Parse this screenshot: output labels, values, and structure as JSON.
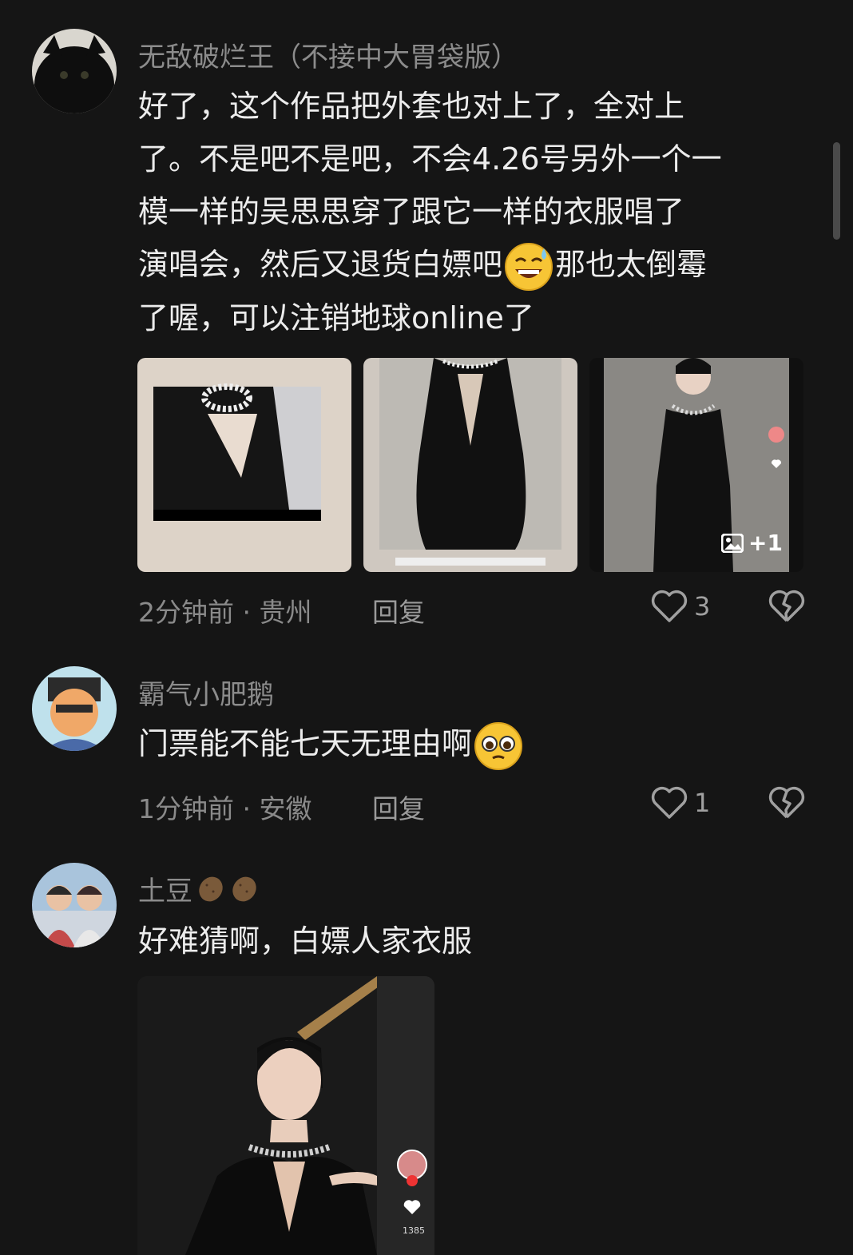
{
  "comments": [
    {
      "username": "无敌破烂王（不接中大胃袋版）",
      "text_lines": [
        "好了，这个作品把外套也对上了，全对上",
        "了。不是吧不是吧，不会4.26号另外一个一",
        "模一样的吴思思穿了跟它一样的衣服唱了"
      ],
      "line4_before": "演唱会，然后又退货白嫖吧",
      "line4_after": "那也太倒霉",
      "line5": "了喔，可以注销地球online了",
      "meta": "2分钟前 · 贵州",
      "reply": "回复",
      "likes": "3",
      "images_extra": "+1"
    },
    {
      "username": "霸气小肥鹅",
      "text": "门票能不能七天无理由啊",
      "meta": "1分钟前 · 安徽",
      "reply": "回复",
      "likes": "1"
    },
    {
      "username": "土豆",
      "text": "好难猜啊，白嫖人家衣服",
      "video_like_count": "1385"
    }
  ],
  "colors": {
    "background": "#151515",
    "text": "#ececec",
    "muted": "#8a8a8a"
  },
  "icons": [
    "heart-icon",
    "broken-heart-icon",
    "gallery-icon",
    "grin-sweat-emoji",
    "pleading-emoji",
    "potato-icon"
  ]
}
